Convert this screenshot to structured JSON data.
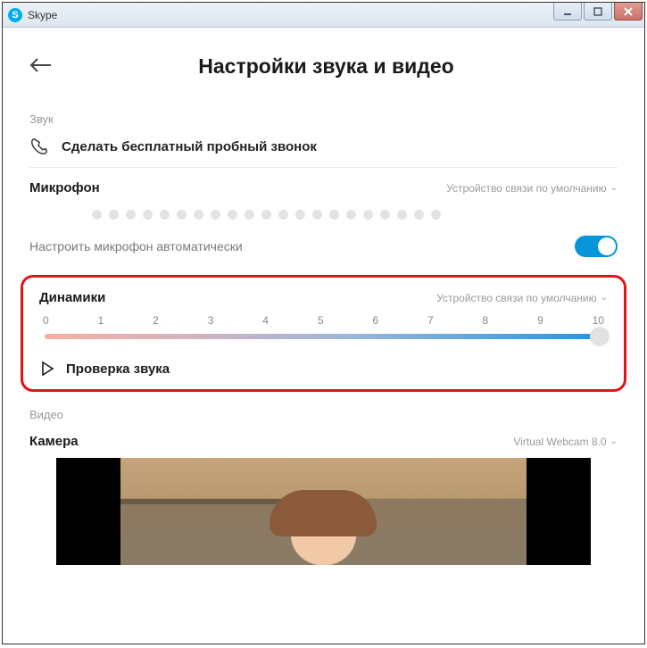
{
  "window": {
    "title": "Skype"
  },
  "page": {
    "title": "Настройки звука и видео"
  },
  "sound": {
    "section_label": "Звук",
    "test_call": "Сделать бесплатный пробный звонок"
  },
  "microphone": {
    "heading": "Микрофон",
    "device": "Устройство связи по умолчанию",
    "auto_label": "Настроить микрофон автоматически",
    "auto_on": true
  },
  "speakers": {
    "heading": "Динамики",
    "device": "Устройство связи по умолчанию",
    "ticks": [
      "0",
      "1",
      "2",
      "3",
      "4",
      "5",
      "6",
      "7",
      "8",
      "9",
      "10"
    ],
    "value": 10,
    "test_audio": "Проверка звука"
  },
  "video": {
    "section_label": "Видео",
    "camera_heading": "Камера",
    "camera_device": "Virtual Webcam 8.0"
  }
}
